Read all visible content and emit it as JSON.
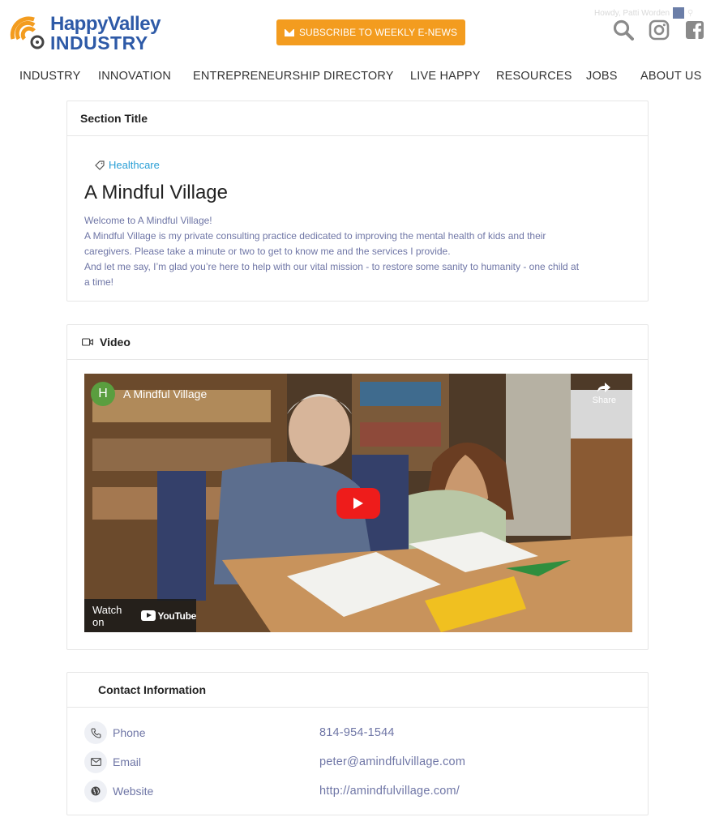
{
  "brand": {
    "line1": "HappyValley",
    "line2": "INDUSTRY",
    "accent": "#f39c1f",
    "blue": "#2e5aa7"
  },
  "subscribe": {
    "label": "SUBSCRIBE TO WEEKLY E-NEWS"
  },
  "user": {
    "greeting": "Howdy, Patti Worden"
  },
  "header_icons": [
    "search-icon",
    "instagram-icon",
    "facebook-icon"
  ],
  "nav": {
    "items": [
      "INDUSTRY",
      "INNOVATION",
      "ENTREPRENEURSHIP",
      "DIRECTORY",
      "LIVE HAPPY",
      "RESOURCES",
      "JOBS",
      "ABOUT US"
    ]
  },
  "section": {
    "heading": "Section Title",
    "tag": "Healthcare",
    "title": "A Mindful Village",
    "paragraphs": [
      "Welcome to A Mindful Village!",
      "A Mindful Village is my private consulting practice dedicated to improving the mental health of kids and their caregivers. Please take a minute or two to get to know me and the services I provide.",
      "And let me say, I’m glad you’re here to help with our vital mission - to restore some sanity to humanity - one child at a time!"
    ]
  },
  "video": {
    "heading": "Video",
    "channel_initial": "H",
    "video_title": "A Mindful Village",
    "share_label": "Share",
    "watch_on": "Watch on",
    "youtube": "YouTube"
  },
  "contact": {
    "heading": "Contact Information",
    "rows": [
      {
        "label": "Phone",
        "value": "814-954-1544",
        "icon": "phone-icon"
      },
      {
        "label": "Email",
        "value": "peter@amindfulvillage.com",
        "icon": "email-icon"
      },
      {
        "label": "Website",
        "value": "http://amindfulvillage.com/",
        "icon": "globe-icon"
      }
    ]
  }
}
